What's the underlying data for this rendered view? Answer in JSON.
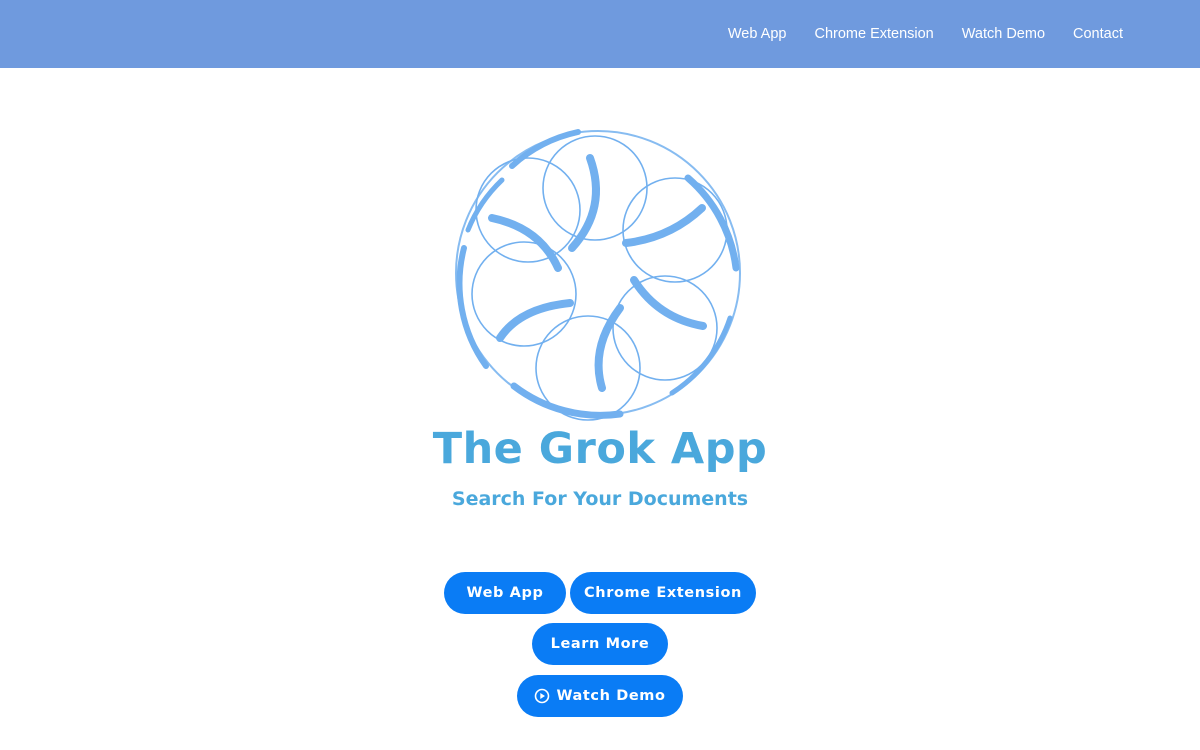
{
  "nav": {
    "links": [
      {
        "label": "Web App"
      },
      {
        "label": "Chrome Extension"
      },
      {
        "label": "Watch Demo"
      },
      {
        "label": "Contact"
      }
    ]
  },
  "hero": {
    "logo_icon": "swirl-logo-icon",
    "title": "The Grok App",
    "subtitle": "Search For Your Documents"
  },
  "buttons": {
    "web_app": "Web App",
    "chrome_extension": "Chrome Extension",
    "learn_more": "Learn More",
    "watch_demo": "Watch Demo",
    "watch_demo_icon": "play-circle-icon"
  },
  "colors": {
    "nav_bg": "#6f9ade",
    "title": "#4aa8dc",
    "button_bg": "#0a7cf5",
    "logo_stroke": "#72b0ef"
  }
}
